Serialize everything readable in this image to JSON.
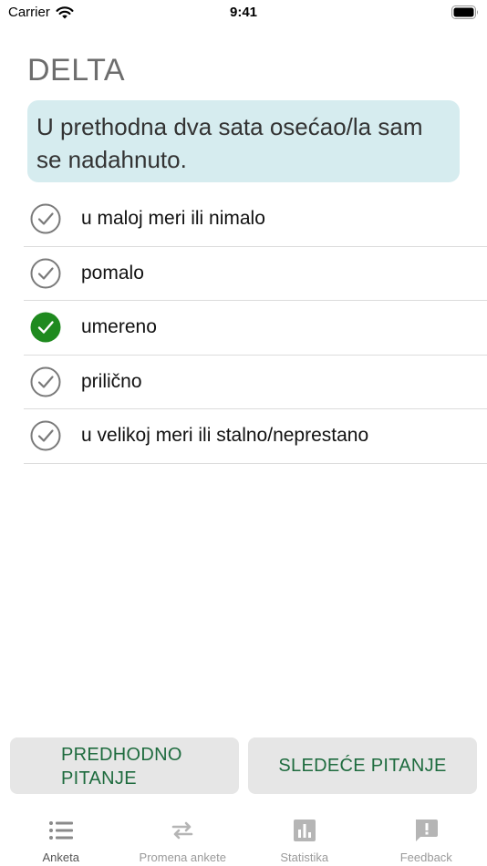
{
  "status_bar": {
    "carrier": "Carrier",
    "time": "9:41"
  },
  "survey": {
    "title": "DELTA",
    "question": "U prethodna dva sata osećao/la sam se nadahnuto."
  },
  "options": [
    {
      "label": "u maloj meri ili nimalo",
      "selected": false
    },
    {
      "label": "pomalo",
      "selected": false
    },
    {
      "label": "umereno",
      "selected": true
    },
    {
      "label": "prilično",
      "selected": false
    },
    {
      "label": "u velikoj meri ili stalno/neprestano",
      "selected": false
    }
  ],
  "buttons": {
    "previous": "PREDHODNO PITANJE",
    "next": "SLEDEĆE PITANJE"
  },
  "tabs": [
    {
      "label": "Anketa",
      "icon": "list-icon",
      "active": true
    },
    {
      "label": "Promena ankete",
      "icon": "swap-arrows-icon",
      "active": false
    },
    {
      "label": "Statistika",
      "icon": "bar-chart-icon",
      "active": false
    },
    {
      "label": "Feedback",
      "icon": "feedback-icon",
      "active": false
    }
  ],
  "colors": {
    "accent_green": "#1e6b3e",
    "selected_check": "#1f8a1f",
    "question_bg": "#d6ecef",
    "button_bg": "#e6e6e6"
  }
}
